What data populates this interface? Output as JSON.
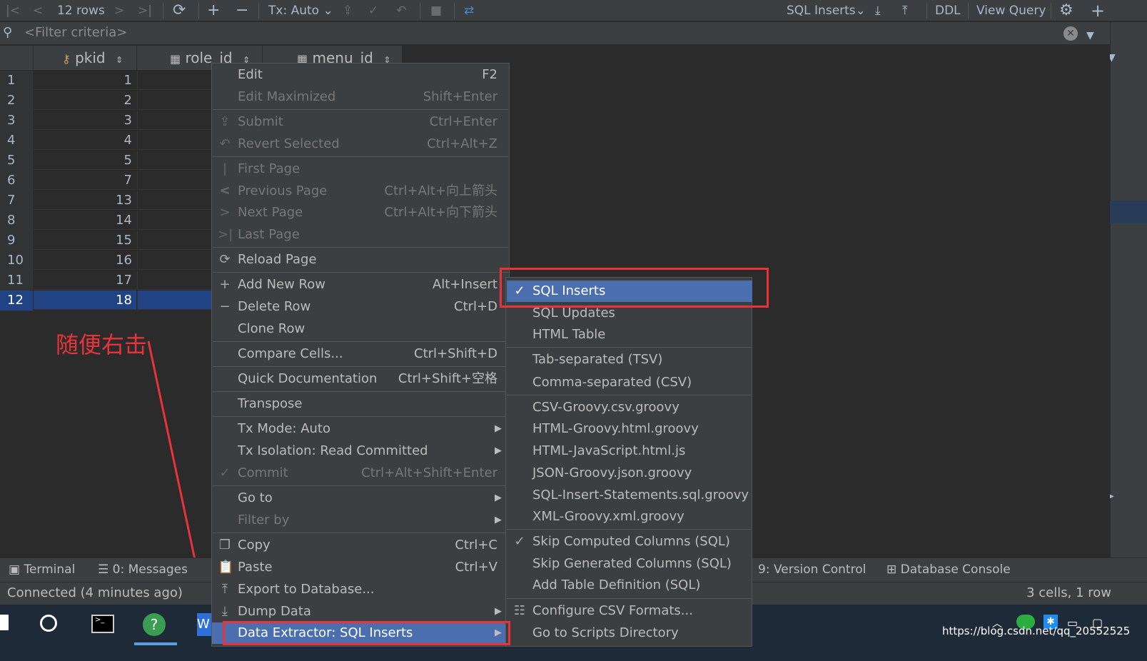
{
  "toolbar": {
    "rows": "12 rows",
    "tx_mode": "Tx: Auto",
    "extractor": "SQL Inserts",
    "ddl": "DDL",
    "view_query": "View Query"
  },
  "filter": {
    "placeholder": "<Filter criteria>"
  },
  "columns": [
    "pkid",
    "role_id",
    "menu_id"
  ],
  "rows": [
    {
      "n": "1",
      "pkid": "1"
    },
    {
      "n": "2",
      "pkid": "2"
    },
    {
      "n": "3",
      "pkid": "3"
    },
    {
      "n": "4",
      "pkid": "4"
    },
    {
      "n": "5",
      "pkid": "5"
    },
    {
      "n": "6",
      "pkid": "7"
    },
    {
      "n": "7",
      "pkid": "13"
    },
    {
      "n": "8",
      "pkid": "14"
    },
    {
      "n": "9",
      "pkid": "15"
    },
    {
      "n": "10",
      "pkid": "16"
    },
    {
      "n": "11",
      "pkid": "17"
    },
    {
      "n": "12",
      "pkid": "18"
    }
  ],
  "context_menu": [
    {
      "label": "Edit",
      "shortcut": "F2"
    },
    {
      "label": "Edit Maximized",
      "shortcut": "Shift+Enter"
    },
    {
      "label": "Submit",
      "shortcut": "Ctrl+Enter"
    },
    {
      "label": "Revert Selected",
      "shortcut": "Ctrl+Alt+Z"
    },
    {
      "label": "First Page",
      "shortcut": ""
    },
    {
      "label": "Previous Page",
      "shortcut": "Ctrl+Alt+向上箭头"
    },
    {
      "label": "Next Page",
      "shortcut": "Ctrl+Alt+向下箭头"
    },
    {
      "label": "Last Page",
      "shortcut": ""
    },
    {
      "label": "Reload Page",
      "shortcut": ""
    },
    {
      "label": "Add New Row",
      "shortcut": "Alt+Insert"
    },
    {
      "label": "Delete Row",
      "shortcut": "Ctrl+D"
    },
    {
      "label": "Clone Row",
      "shortcut": ""
    },
    {
      "label": "Compare Cells...",
      "shortcut": "Ctrl+Shift+D"
    },
    {
      "label": "Quick Documentation",
      "shortcut": "Ctrl+Shift+空格"
    },
    {
      "label": "Transpose",
      "shortcut": ""
    },
    {
      "label": "Tx Mode: Auto",
      "shortcut": ""
    },
    {
      "label": "Tx Isolation: Read Committed",
      "shortcut": ""
    },
    {
      "label": "Commit",
      "shortcut": "Ctrl+Alt+Shift+Enter"
    },
    {
      "label": "Go to",
      "shortcut": ""
    },
    {
      "label": "Filter by",
      "shortcut": ""
    },
    {
      "label": "Copy",
      "shortcut": "Ctrl+C"
    },
    {
      "label": "Paste",
      "shortcut": "Ctrl+V"
    },
    {
      "label": "Export to Database...",
      "shortcut": ""
    },
    {
      "label": "Dump Data",
      "shortcut": ""
    },
    {
      "label": "Data Extractor: SQL Inserts",
      "shortcut": ""
    }
  ],
  "submenu": [
    "SQL Inserts",
    "SQL Updates",
    "HTML Table",
    "Tab-separated (TSV)",
    "Comma-separated (CSV)",
    "CSV-Groovy.csv.groovy",
    "HTML-Groovy.html.groovy",
    "HTML-JavaScript.html.js",
    "JSON-Groovy.json.groovy",
    "SQL-Insert-Statements.sql.groovy",
    "XML-Groovy.xml.groovy",
    "Skip Computed Columns (SQL)",
    "Skip Generated Columns (SQL)",
    "Add Table Definition (SQL)",
    "Configure CSV Formats...",
    "Go to Scripts Directory"
  ],
  "tooltabs": {
    "terminal": "Terminal",
    "messages": "0: Messages",
    "version_control": "9: Version Control",
    "database_console": "Database Console"
  },
  "status": {
    "connected": "Connected (4 minutes ago)",
    "cells": "3 cells, 1 row"
  },
  "annotation": {
    "text": "随便右击"
  },
  "watermark": "https://blog.csdn.net/qq_20552525",
  "colors": {
    "accent": "#4b6eaf",
    "selection": "#214283",
    "annotation": "#e8333a"
  }
}
